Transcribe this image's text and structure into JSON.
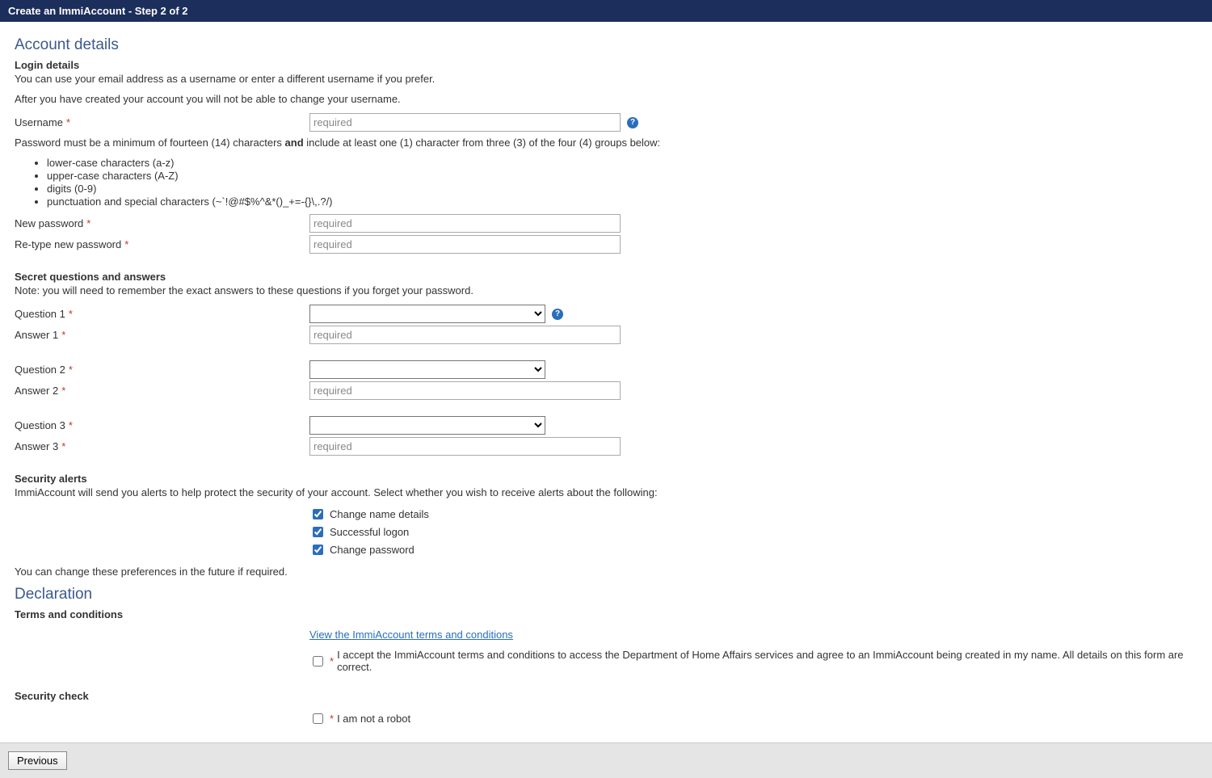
{
  "banner": {
    "title": "Create an ImmiAccount - Step 2 of 2"
  },
  "account": {
    "heading": "Account details",
    "login": {
      "sub": "Login details",
      "desc": "You can use your email address as a username or enter a different username if you prefer.",
      "noteChange": "After you have created your account you will not be able to change your username.",
      "usernameLabel": "Username",
      "placeholder": "required",
      "pwIntroA": "Password must be a minimum of fourteen (14) characters ",
      "pwIntroBold": "and",
      "pwIntroB": " include at least one (1) character from three (3) of the four (4) groups below:",
      "rules": [
        "lower-case characters (a-z)",
        "upper-case characters (A-Z)",
        "digits (0-9)",
        "punctuation and special characters (~`!@#$%^&*()_+=-{}\\,.?/)"
      ],
      "newPassword": "New password",
      "retypePassword": "Re-type new password"
    },
    "secret": {
      "sub": "Secret questions and answers",
      "note": "Note: you will need to remember the exact answers to these questions if you forget your password.",
      "q1": "Question 1",
      "a1": "Answer 1",
      "q2": "Question 2",
      "a2": "Answer 2",
      "q3": "Question 3",
      "a3": "Answer 3",
      "placeholder": "required"
    },
    "alerts": {
      "sub": "Security alerts",
      "desc": "ImmiAccount will send you alerts to help protect the security of your account. Select whether you wish to receive alerts about the following:",
      "opts": {
        "changeName": "Change name details",
        "successfulLogon": "Successful logon",
        "changePassword": "Change password"
      },
      "futureNote": "You can change these preferences in the future if required."
    }
  },
  "declaration": {
    "heading": "Declaration",
    "terms": {
      "sub": "Terms and conditions",
      "link": "View the ImmiAccount terms and conditions",
      "acceptText": "I accept the ImmiAccount terms and conditions to access the Department of Home Affairs services and agree to an ImmiAccount being created in my name. All details on this form are correct."
    },
    "security": {
      "sub": "Security check",
      "robot": "I am not a robot"
    }
  },
  "footer": {
    "previous": "Previous"
  }
}
